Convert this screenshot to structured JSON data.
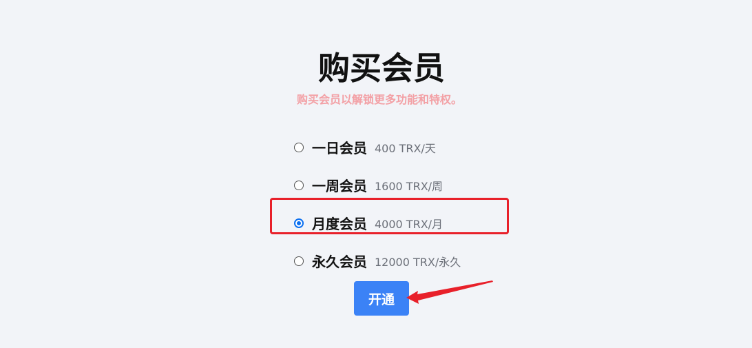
{
  "header": {
    "title": "购买会员",
    "subtitle": "购买会员以解锁更多功能和特权。"
  },
  "plans": [
    {
      "name": "一日会员",
      "price": "400 TRX/天",
      "selected": false
    },
    {
      "name": "一周会员",
      "price": "1600 TRX/周",
      "selected": false
    },
    {
      "name": "月度会员",
      "price": "4000 TRX/月",
      "selected": true
    },
    {
      "name": "永久会员",
      "price": "12000 TRX/永久",
      "selected": false
    }
  ],
  "actions": {
    "open_label": "开通"
  },
  "colors": {
    "accent": "#3b82f6",
    "radio_selected": "#0b6ff0",
    "annotation": "#e8202a",
    "subtitle": "#f3a0a5"
  }
}
